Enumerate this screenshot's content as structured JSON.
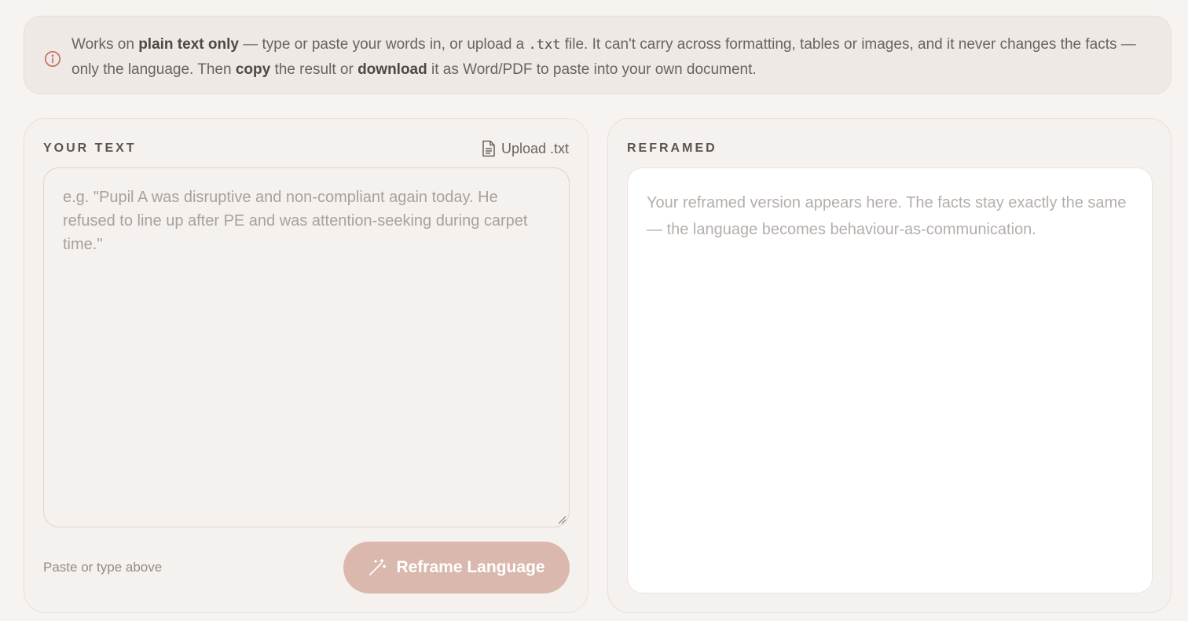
{
  "notice": {
    "icon": "info-icon",
    "t1": "Works on ",
    "b1": "plain text only",
    "t2": " — type or paste your words in, or upload a ",
    "code": ".txt",
    "t3": " file. It can't carry across formatting, tables or images, and it never changes the facts — only the language. Then ",
    "b2": "copy",
    "t4": " the result or ",
    "b3": "download",
    "t5": " it as Word/PDF to paste into your own document."
  },
  "input_panel": {
    "label": "YOUR TEXT",
    "upload_label": "Upload .txt",
    "upload_icon": "file-icon",
    "placeholder": "e.g. \"Pupil A was disruptive and non-compliant again today. He refused to line up after PE and was attention-seeking during carpet time.\"",
    "value": "",
    "hint": "Paste or type above",
    "button_label": "Reframe Language",
    "button_icon": "magic-wand-icon"
  },
  "output_panel": {
    "label": "REFRAMED",
    "placeholder": "Your reframed version appears here. The facts stay exactly the same — the language becomes behaviour-as-communication."
  },
  "colors": {
    "background": "#f7f3f0",
    "accent": "#dbb8ad",
    "info_icon": "#c0705e"
  }
}
